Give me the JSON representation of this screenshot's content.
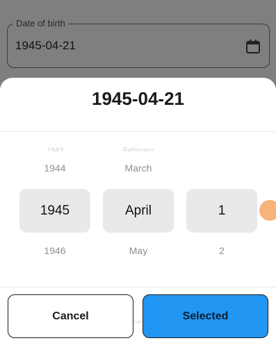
{
  "field": {
    "label": "Date of birth",
    "value": "1945-04-21"
  },
  "sheet": {
    "title": "1945-04-21",
    "year": {
      "prev": "1944",
      "selected": "1945",
      "next": "1946"
    },
    "month": {
      "prev": "March",
      "selected": "April",
      "next": "May"
    },
    "day": {
      "prev": "",
      "selected": "1",
      "next": "2"
    },
    "cancel_label": "Cancel",
    "confirm_label": "Selected"
  },
  "colors": {
    "accent": "#2196f3",
    "scrim": "#7f7f7f",
    "selected_bg": "#e9e9e9",
    "handle": "#f7b37a"
  },
  "icons": {
    "field_icon": "calendar-icon"
  }
}
